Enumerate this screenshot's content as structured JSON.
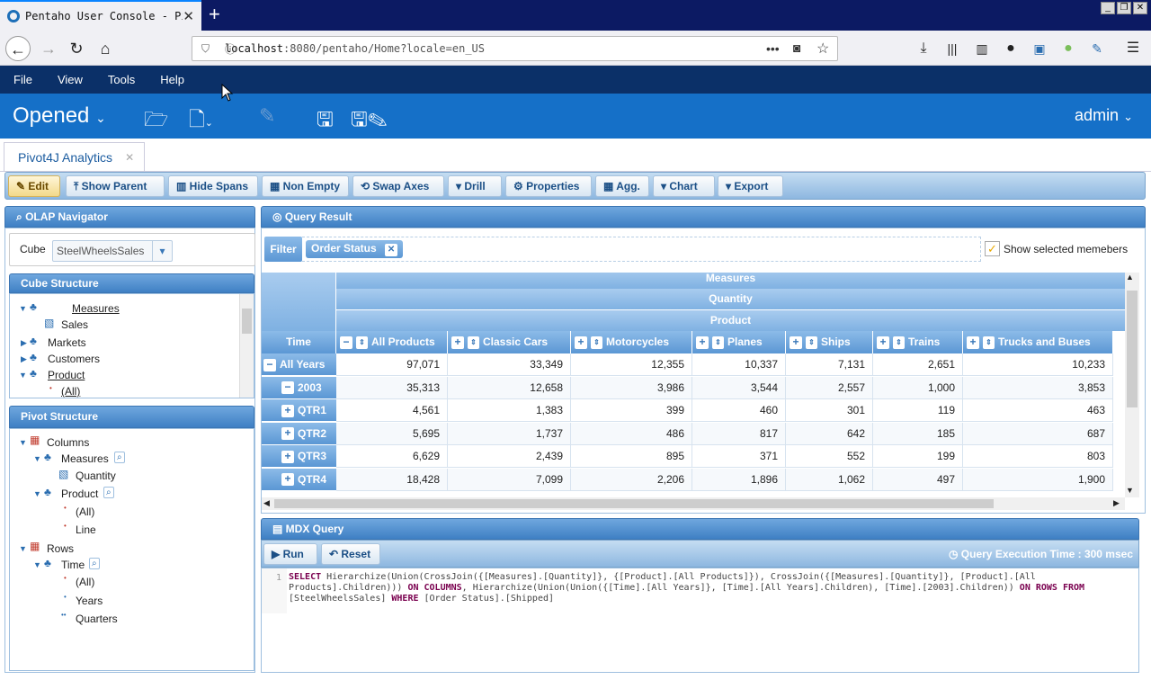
{
  "browser": {
    "tab_title": "Pentaho User Console - Pivo",
    "url_host": "localhost",
    "url_rest": ":8080/pentaho/Home?locale=en_US"
  },
  "menu": {
    "file": "File",
    "view": "View",
    "tools": "Tools",
    "help": "Help"
  },
  "header": {
    "opened": "Opened",
    "user": "admin"
  },
  "app_tab": {
    "label": "Pivot4J Analytics"
  },
  "pivot_toolbar": {
    "edit": "Edit",
    "show_parent": "Show Parent",
    "hide_spans": "Hide Spans",
    "non_empty": "Non Empty",
    "swap_axes": "Swap Axes",
    "drill": "Drill",
    "properties": "Properties",
    "agg": "Agg.",
    "chart": "Chart",
    "export": "Export"
  },
  "olap_navigator": {
    "title": "OLAP Navigator",
    "cube_label": "Cube",
    "cube_value": "SteelWheelsSales",
    "cube_structure_title": "Cube Structure",
    "cube_tree": [
      "Measures",
      "Sales",
      "Markets",
      "Customers",
      "Product",
      "(All)"
    ]
  },
  "pivot_structure": {
    "title": "Pivot Structure",
    "items": [
      "Columns",
      "Measures",
      "Quantity",
      "Product",
      "(All)",
      "Line",
      "Rows",
      "Time",
      "(All)",
      "Years",
      "Quarters"
    ]
  },
  "query_result": {
    "title": "Query Result",
    "filter_label": "Filter",
    "filter_chip": "Order Status",
    "show_selected": "Show selected memebers",
    "header_rows": [
      "Measures",
      "Quantity",
      "Product"
    ],
    "corner": "Time",
    "columns": [
      "All Products",
      "Classic Cars",
      "Motorcycles",
      "Planes",
      "Ships",
      "Trains",
      "Trucks and Buses"
    ],
    "rows": [
      {
        "label": "All Years",
        "values": [
          "97,071",
          "33,349",
          "12,355",
          "10,337",
          "7,131",
          "2,651",
          "10,233"
        ]
      },
      {
        "label": "2003",
        "values": [
          "35,313",
          "12,658",
          "3,986",
          "3,544",
          "2,557",
          "1,000",
          "3,853"
        ]
      },
      {
        "label": "QTR1",
        "values": [
          "4,561",
          "1,383",
          "399",
          "460",
          "301",
          "119",
          "463"
        ]
      },
      {
        "label": "QTR2",
        "values": [
          "5,695",
          "1,737",
          "486",
          "817",
          "642",
          "185",
          "687"
        ]
      },
      {
        "label": "QTR3",
        "values": [
          "6,629",
          "2,439",
          "895",
          "371",
          "552",
          "199",
          "803"
        ]
      },
      {
        "label": "QTR4",
        "values": [
          "18,428",
          "7,099",
          "2,206",
          "1,896",
          "1,062",
          "497",
          "1,900"
        ]
      }
    ]
  },
  "mdx": {
    "title": "MDX Query",
    "run": "Run",
    "reset": "Reset",
    "exec_time": "Query Execution Time : 300 msec",
    "line_no": "1",
    "tok": {
      "select": "SELECT",
      "a": " Hierarchize(Union(CrossJoin({[Measures].[Quantity]}, {[Product].[All Products]}), CrossJoin({[Measures].[Quantity]}, [Product].[All",
      "b": "Products].Children))) ",
      "on_columns": "ON COLUMNS",
      "c": ", Hierarchize(Union(Union({[Time].[All Years]}, [Time].[All Years].Children), [Time].[2003].Children)) ",
      "on_rows_from": "ON ROWS FROM",
      "d": "[SteelWheelsSales] ",
      "where": "WHERE",
      "e": " [Order Status].[Shipped]"
    }
  }
}
